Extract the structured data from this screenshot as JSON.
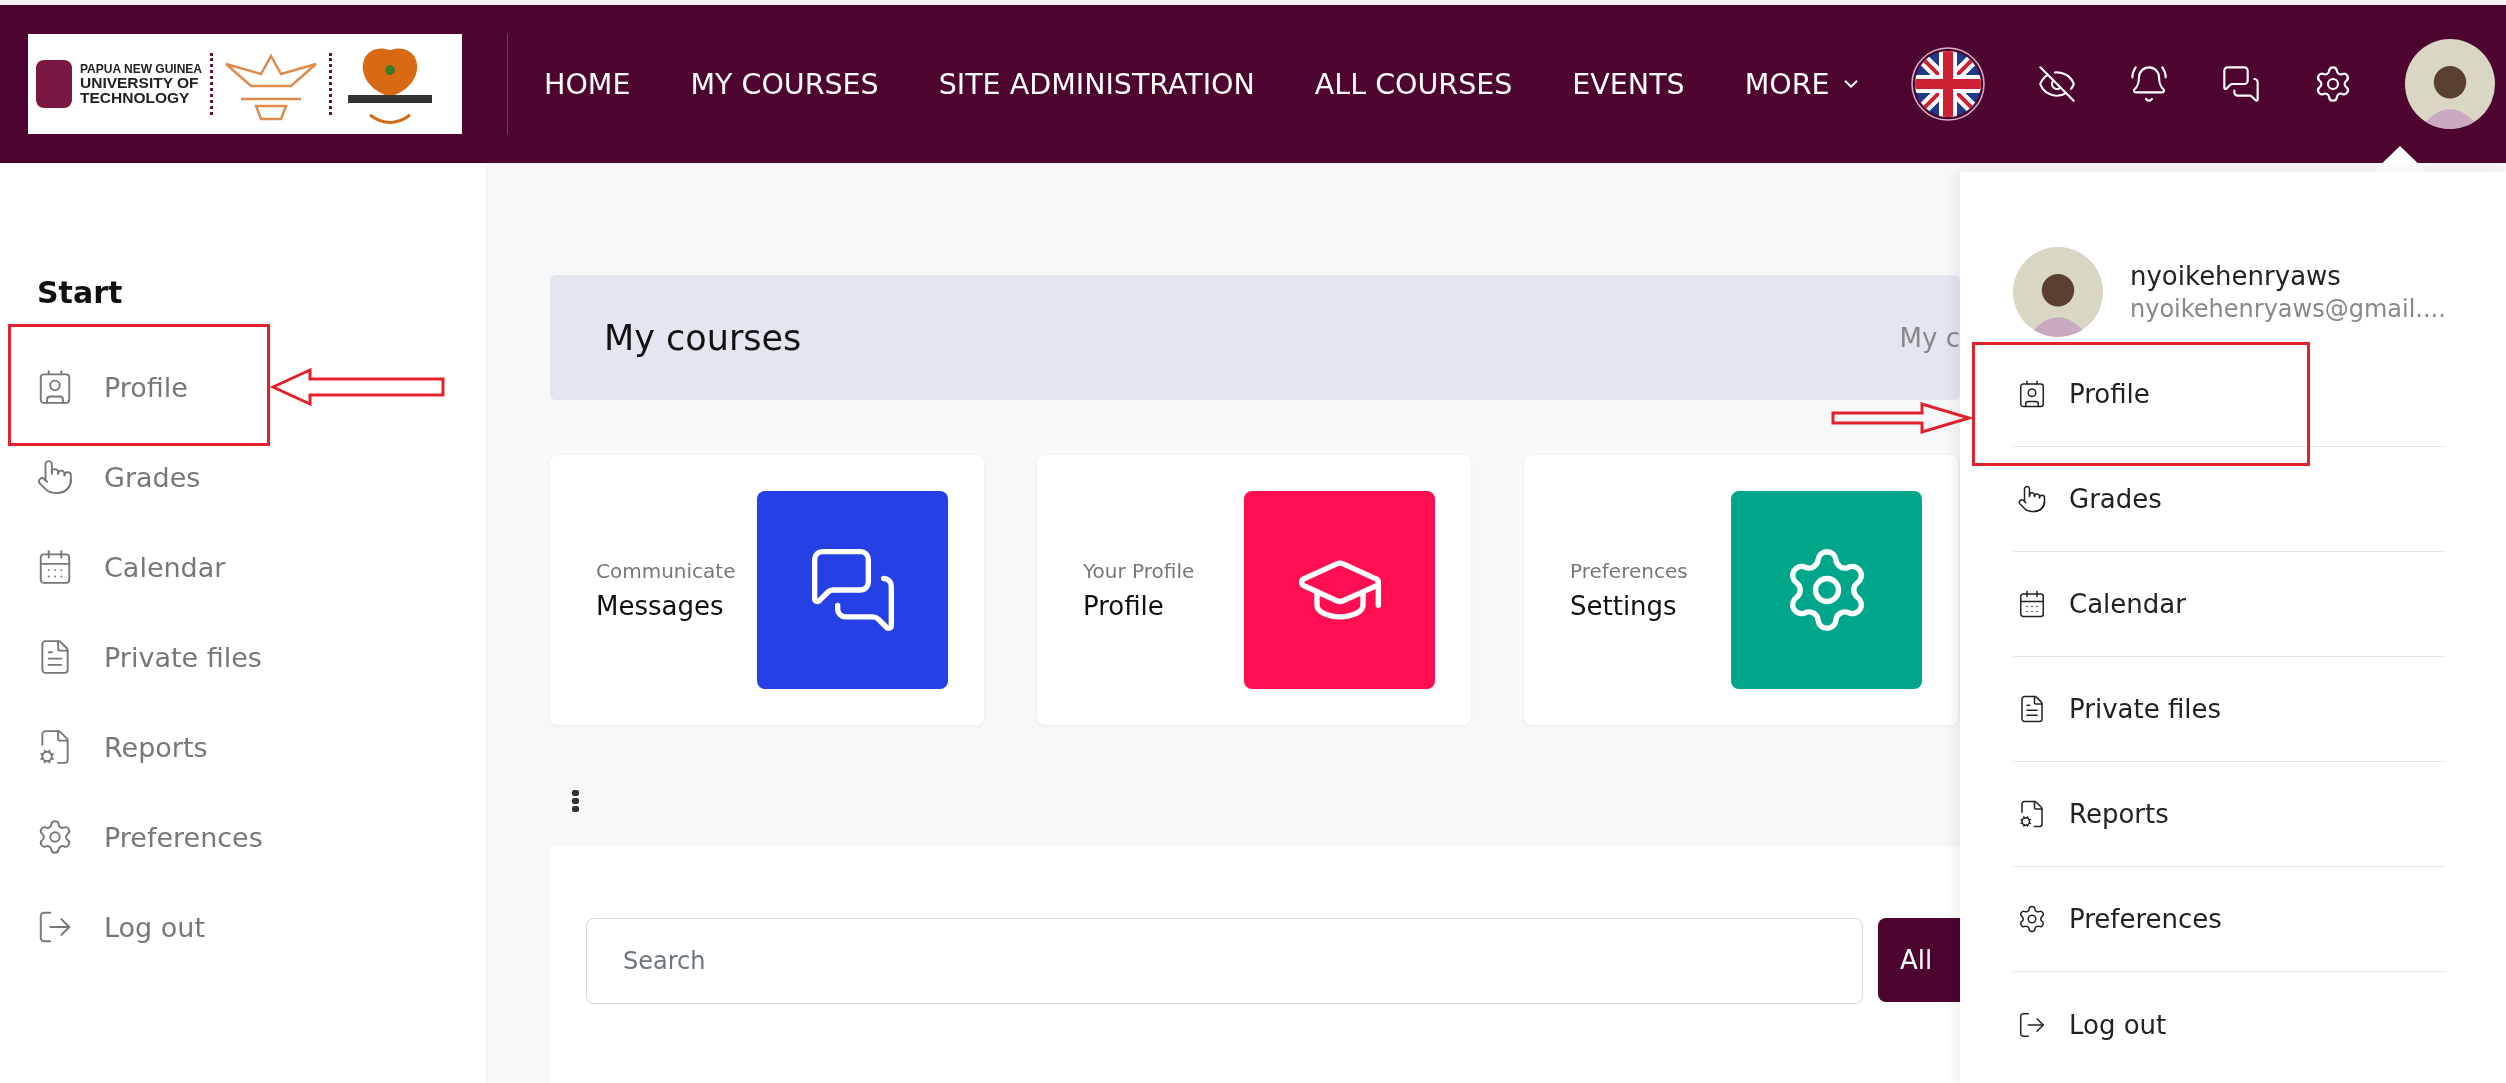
{
  "header": {
    "logo_lines": [
      "PAPUA NEW GUINEA",
      "UNIVERSITY OF",
      "TECHNOLOGY"
    ],
    "nav": [
      {
        "label": "HOME",
        "has_menu": false
      },
      {
        "label": "MY COURSES",
        "has_menu": false
      },
      {
        "label": "SITE ADMINISTRATION",
        "has_menu": false
      },
      {
        "label": "ALL COURSES",
        "has_menu": false
      },
      {
        "label": "EVENTS",
        "has_menu": false
      },
      {
        "label": "MORE",
        "has_menu": true
      }
    ]
  },
  "sidebar": {
    "heading": "Start",
    "items": [
      {
        "label": "Profile",
        "highlighted": true
      },
      {
        "label": "Grades",
        "highlighted": false
      },
      {
        "label": "Calendar",
        "highlighted": false
      },
      {
        "label": "Private files",
        "highlighted": false
      },
      {
        "label": "Reports",
        "highlighted": false
      },
      {
        "label": "Preferences",
        "highlighted": false
      },
      {
        "label": "Log out",
        "highlighted": false
      }
    ]
  },
  "main": {
    "title": "My courses",
    "breadcrumb": "My c",
    "cards": [
      {
        "caption": "Communicate",
        "title": "Messages",
        "color": "#2541e6"
      },
      {
        "caption": "Your Profile",
        "title": "Profile",
        "color": "#ff0f50"
      },
      {
        "caption": "Preferences",
        "title": "Settings",
        "color": "#00a68a"
      }
    ],
    "search": {
      "placeholder": "Search"
    },
    "filter_button": "All"
  },
  "user_menu": {
    "name": "nyoikehenryaws",
    "email": "nyoikehenryaws@gmail....",
    "items": [
      {
        "label": "Profile",
        "highlighted": true
      },
      {
        "label": "Grades",
        "highlighted": false
      },
      {
        "label": "Calendar",
        "highlighted": false
      },
      {
        "label": "Private files",
        "highlighted": false
      },
      {
        "label": "Reports",
        "highlighted": false
      },
      {
        "label": "Preferences",
        "highlighted": false
      },
      {
        "label": "Log out",
        "highlighted": false
      }
    ]
  }
}
